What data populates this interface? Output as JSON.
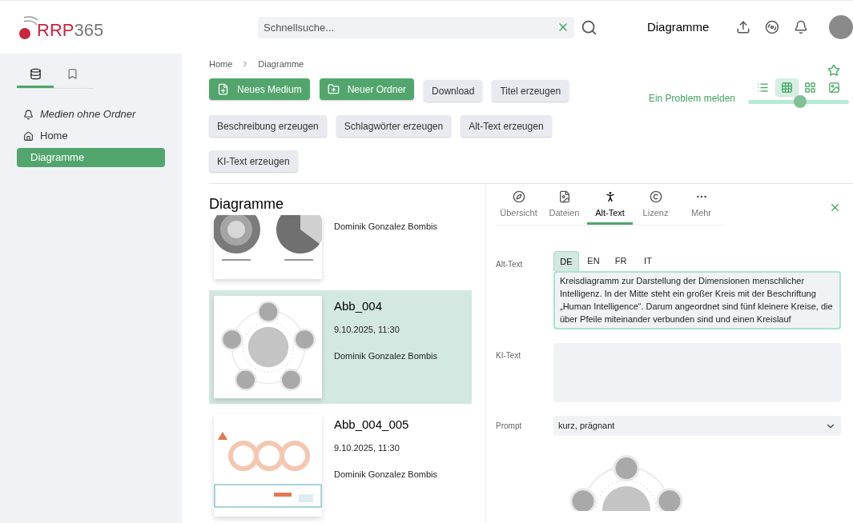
{
  "header": {
    "logo_prefix": "RRP",
    "logo_suffix": "365",
    "search": {
      "placeholder": "Schnellsuche..."
    },
    "title": "Diagramme"
  },
  "sidebar": {
    "tabs": [
      {
        "kind": "database",
        "selected": true
      },
      {
        "kind": "bookmark",
        "selected": false
      }
    ],
    "items": [
      {
        "label": "Medien ohne Ordner",
        "kind": "unfiled",
        "selected": false
      },
      {
        "label": "Home",
        "kind": "home",
        "selected": false
      },
      {
        "label": "Diagramme",
        "kind": "folder",
        "selected": true
      }
    ]
  },
  "breadcrumb": [
    "Home",
    "Diagramme"
  ],
  "actions": [
    {
      "label": "Neues Medium",
      "kind": "new-medium"
    },
    {
      "label": "Neuer Ordner",
      "kind": "new-folder"
    },
    {
      "label": "Download",
      "kind": "secondary"
    },
    {
      "label": "Titel erzeugen",
      "kind": "secondary"
    },
    {
      "label": "Beschreibung erzeugen",
      "kind": "secondary"
    },
    {
      "label": "Schlagwörter erzeugen",
      "kind": "secondary"
    },
    {
      "label": "Alt-Text erzeugen",
      "kind": "secondary"
    },
    {
      "label": "KI-Text erzeugen",
      "kind": "secondary"
    }
  ],
  "report_link": "Ein Problem melden",
  "view_modes": [
    {
      "kind": "list",
      "selected": false
    },
    {
      "kind": "table",
      "selected": true
    },
    {
      "kind": "tiles",
      "selected": false
    },
    {
      "kind": "image",
      "selected": false
    }
  ],
  "size_slider": {
    "level": 0.52
  },
  "list": {
    "title": "Diagramme",
    "items": [
      {
        "kind": "rings",
        "author": "Dominik Gonzalez Bombis",
        "selected": false
      },
      {
        "title": "Abb_004",
        "date": "9.10.2025, 11:30",
        "author": "Dominik Gonzalez Bombis",
        "kind": "cycle",
        "selected": true
      },
      {
        "title": "Abb_004_005",
        "date": "9.10.2025, 11:30",
        "author": "Dominik Gonzalez Bombis",
        "kind": "flow",
        "selected": false
      }
    ]
  },
  "detail": {
    "tabs": [
      {
        "label": "Übersicht",
        "selected": false
      },
      {
        "label": "Dateien",
        "selected": false
      },
      {
        "label": "Alt-Text",
        "selected": true
      },
      {
        "label": "Lizenz",
        "selected": false
      },
      {
        "label": "Mehr",
        "selected": false
      }
    ],
    "alt_text": {
      "label": "Alt-Text",
      "languages": [
        {
          "label": "DE",
          "selected": true
        },
        {
          "label": "EN",
          "selected": false
        },
        {
          "label": "FR",
          "selected": false
        },
        {
          "label": "IT",
          "selected": false
        }
      ],
      "value": "Kreisdiagramm zur Darstellung der Dimensionen menschlicher Intelligenz. In der Mitte steht ein großer Kreis mit der Beschriftung „Human Intelligence“. Darum angeordnet sind fünf kleinere Kreise, die über Pfeile miteinander verbunden sind und einen Kreislauf"
    },
    "ki_text": {
      "label": "KI-Text"
    },
    "prompt": {
      "label": "Prompt",
      "value": "kurz, prägnant"
    },
    "preview": {
      "kind": "cycle"
    }
  }
}
